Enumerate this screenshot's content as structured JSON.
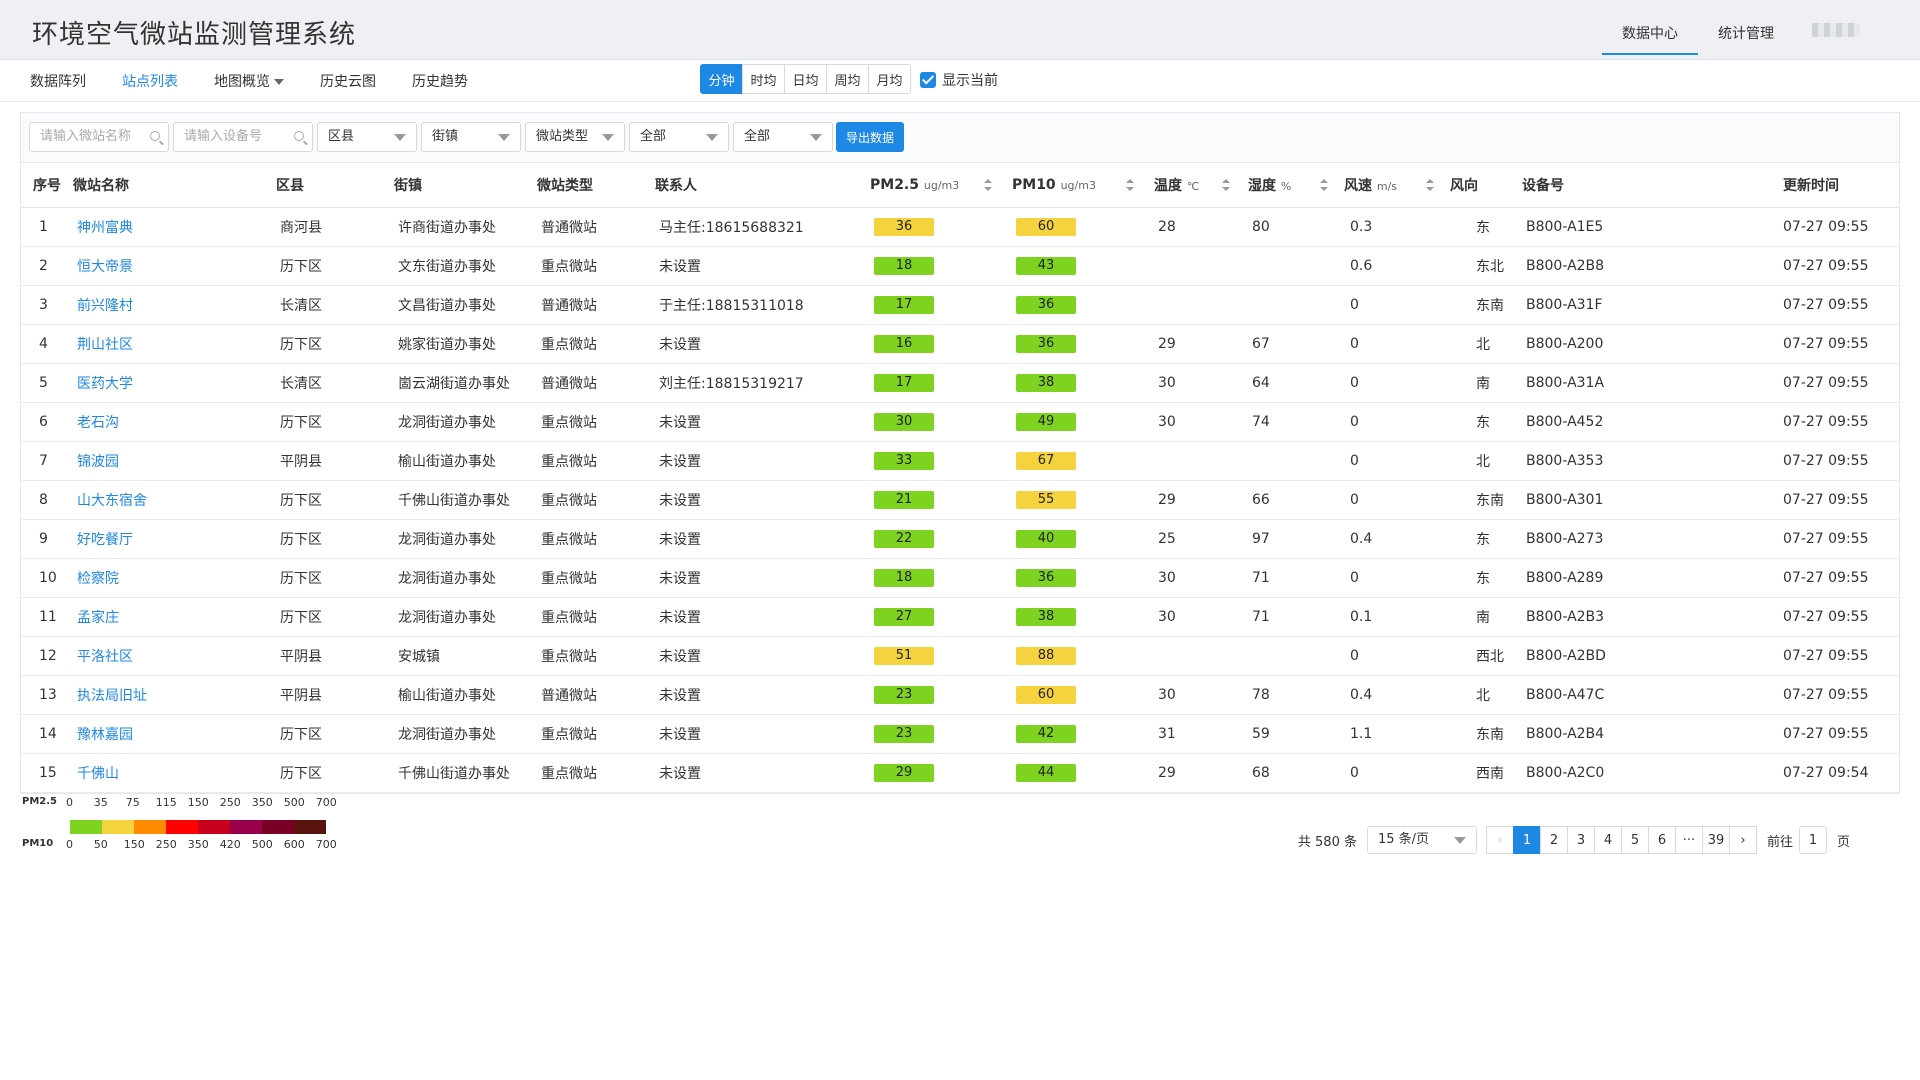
{
  "app": {
    "title": "环境空气微站监测管理系统"
  },
  "top_nav": {
    "items": [
      "数据中心",
      "统计管理"
    ],
    "active": 0
  },
  "subnav": {
    "tabs": [
      "数据阵列",
      "站点列表",
      "地图概览",
      "历史云图",
      "历史趋势"
    ],
    "active": 1
  },
  "period": {
    "buttons": [
      "分钟",
      "时均",
      "日均",
      "周均",
      "月均"
    ],
    "active": 0
  },
  "show_current": {
    "label": "显示当前",
    "checked": true
  },
  "filters": {
    "station_name_placeholder": "请输入微站名称",
    "device_no_placeholder": "请输入设备号",
    "district": "区县",
    "street": "街镇",
    "station_type": "微站类型",
    "all_1": "全部",
    "all_2": "全部",
    "export_label": "导出数据"
  },
  "table": {
    "headers": {
      "index": "序号",
      "name": "微站名称",
      "district": "区县",
      "street": "街镇",
      "type": "微站类型",
      "contact": "联系人",
      "pm25": "PM2.5",
      "pm25_unit": "ug/m3",
      "pm10": "PM10",
      "pm10_unit": "ug/m3",
      "temp": "温度",
      "temp_unit": "℃",
      "humidity": "湿度",
      "humidity_unit": "%",
      "wind_speed": "风速",
      "wind_speed_unit": "m/s",
      "wind_dir": "风向",
      "device": "设备号",
      "updated": "更新时间"
    },
    "rows": [
      {
        "i": "1",
        "name": "神州富典",
        "district": "商河县",
        "street": "许商街道办事处",
        "type": "普通微站",
        "contact": "马主任:18615688321",
        "pm25": 36,
        "pm10": 60,
        "temp": "28",
        "hum": "80",
        "ws": "0.3",
        "wd": "东",
        "dev": "B800-A1E5",
        "time": "07-27 09:55"
      },
      {
        "i": "2",
        "name": "恒大帝景",
        "district": "历下区",
        "street": "文东街道办事处",
        "type": "重点微站",
        "contact": "未设置",
        "pm25": 18,
        "pm10": 43,
        "temp": "",
        "hum": "",
        "ws": "0.6",
        "wd": "东北",
        "dev": "B800-A2B8",
        "time": "07-27 09:55"
      },
      {
        "i": "3",
        "name": "前兴隆村",
        "district": "长清区",
        "street": "文昌街道办事处",
        "type": "普通微站",
        "contact": "于主任:18815311018",
        "pm25": 17,
        "pm10": 36,
        "temp": "",
        "hum": "",
        "ws": "0",
        "wd": "东南",
        "dev": "B800-A31F",
        "time": "07-27 09:55"
      },
      {
        "i": "4",
        "name": "荆山社区",
        "district": "历下区",
        "street": "姚家街道办事处",
        "type": "重点微站",
        "contact": "未设置",
        "pm25": 16,
        "pm10": 36,
        "temp": "29",
        "hum": "67",
        "ws": "0",
        "wd": "北",
        "dev": "B800-A200",
        "time": "07-27 09:55"
      },
      {
        "i": "5",
        "name": "医药大学",
        "district": "长清区",
        "street": "崮云湖街道办事处",
        "type": "普通微站",
        "contact": "刘主任:18815319217",
        "pm25": 17,
        "pm10": 38,
        "temp": "30",
        "hum": "64",
        "ws": "0",
        "wd": "南",
        "dev": "B800-A31A",
        "time": "07-27 09:55"
      },
      {
        "i": "6",
        "name": "老石沟",
        "district": "历下区",
        "street": "龙洞街道办事处",
        "type": "重点微站",
        "contact": "未设置",
        "pm25": 30,
        "pm10": 49,
        "temp": "30",
        "hum": "74",
        "ws": "0",
        "wd": "东",
        "dev": "B800-A452",
        "time": "07-27 09:55"
      },
      {
        "i": "7",
        "name": "锦波园",
        "district": "平阴县",
        "street": "榆山街道办事处",
        "type": "重点微站",
        "contact": "未设置",
        "pm25": 33,
        "pm10": 67,
        "temp": "",
        "hum": "",
        "ws": "0",
        "wd": "北",
        "dev": "B800-A353",
        "time": "07-27 09:55"
      },
      {
        "i": "8",
        "name": "山大东宿舍",
        "district": "历下区",
        "street": "千佛山街道办事处",
        "type": "重点微站",
        "contact": "未设置",
        "pm25": 21,
        "pm10": 55,
        "temp": "29",
        "hum": "66",
        "ws": "0",
        "wd": "东南",
        "dev": "B800-A301",
        "time": "07-27 09:55"
      },
      {
        "i": "9",
        "name": "好吃餐厅",
        "district": "历下区",
        "street": "龙洞街道办事处",
        "type": "重点微站",
        "contact": "未设置",
        "pm25": 22,
        "pm10": 40,
        "temp": "25",
        "hum": "97",
        "ws": "0.4",
        "wd": "东",
        "dev": "B800-A273",
        "time": "07-27 09:55"
      },
      {
        "i": "10",
        "name": "检察院",
        "district": "历下区",
        "street": "龙洞街道办事处",
        "type": "重点微站",
        "contact": "未设置",
        "pm25": 18,
        "pm10": 36,
        "temp": "30",
        "hum": "71",
        "ws": "0",
        "wd": "东",
        "dev": "B800-A289",
        "time": "07-27 09:55"
      },
      {
        "i": "11",
        "name": "孟家庄",
        "district": "历下区",
        "street": "龙洞街道办事处",
        "type": "重点微站",
        "contact": "未设置",
        "pm25": 27,
        "pm10": 38,
        "temp": "30",
        "hum": "71",
        "ws": "0.1",
        "wd": "南",
        "dev": "B800-A2B3",
        "time": "07-27 09:55"
      },
      {
        "i": "12",
        "name": "平洛社区",
        "district": "平阴县",
        "street": "安城镇",
        "type": "重点微站",
        "contact": "未设置",
        "pm25": 51,
        "pm10": 88,
        "temp": "",
        "hum": "",
        "ws": "0",
        "wd": "西北",
        "dev": "B800-A2BD",
        "time": "07-27 09:55"
      },
      {
        "i": "13",
        "name": "执法局旧址",
        "district": "平阴县",
        "street": "榆山街道办事处",
        "type": "普通微站",
        "contact": "未设置",
        "pm25": 23,
        "pm10": 60,
        "temp": "30",
        "hum": "78",
        "ws": "0.4",
        "wd": "北",
        "dev": "B800-A47C",
        "time": "07-27 09:55"
      },
      {
        "i": "14",
        "name": "豫林嘉园",
        "district": "历下区",
        "street": "龙洞街道办事处",
        "type": "重点微站",
        "contact": "未设置",
        "pm25": 23,
        "pm10": 42,
        "temp": "31",
        "hum": "59",
        "ws": "1.1",
        "wd": "东南",
        "dev": "B800-A2B4",
        "time": "07-27 09:55"
      },
      {
        "i": "15",
        "name": "千佛山",
        "district": "历下区",
        "street": "千佛山街道办事处",
        "type": "重点微站",
        "contact": "未设置",
        "pm25": 29,
        "pm10": 44,
        "temp": "29",
        "hum": "68",
        "ws": "0",
        "wd": "西南",
        "dev": "B800-A2C0",
        "time": "07-27 09:54"
      }
    ]
  },
  "legend": {
    "pm25_label": "PM2.5",
    "pm10_label": "PM10",
    "pm25_ticks": [
      "0",
      "35",
      "75",
      "115",
      "150",
      "250",
      "350",
      "500",
      "700"
    ],
    "pm10_ticks": [
      "0",
      "50",
      "150",
      "250",
      "350",
      "420",
      "500",
      "600",
      "700"
    ],
    "colors": [
      "#7ed321",
      "#f4d33e",
      "#ff8c00",
      "#ff0000",
      "#c8001e",
      "#99004c",
      "#7a0026",
      "#5a1410"
    ]
  },
  "pagination": {
    "total": "共 580 条",
    "page_size": "15 条/页",
    "pages": [
      "1",
      "2",
      "3",
      "4",
      "5",
      "6",
      "···",
      "39"
    ],
    "current": "1",
    "goto_label": "前往",
    "goto_value": "1",
    "page_unit": "页"
  }
}
